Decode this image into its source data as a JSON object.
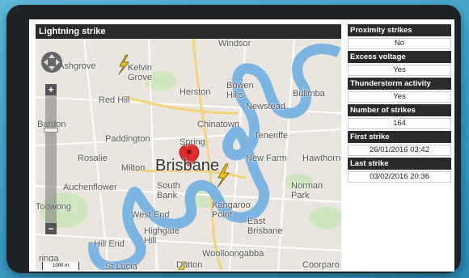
{
  "map": {
    "title": "Lightning strike",
    "labels": {
      "ashgrove": "Ashgrove",
      "kelvin_grove": "Kelvin\nGrove",
      "windsor": "Windsor",
      "red_hill": "Red Hill",
      "herston": "Herston",
      "bowen_hills": "Bowen\nHills",
      "bulimba": "Bulimba",
      "bardon": "Bardon",
      "newstead": "Newstead",
      "chinatown": "Chinatown",
      "paddington": "Paddington",
      "spring": "Spring",
      "teneriffe": "Teneriffe",
      "rosalie": "Rosalie",
      "milton": "Milton",
      "brisbane": "Brisbane",
      "new_farm": "New Farm",
      "hawthorne": "Hawthorne",
      "auchenflower": "Auchenflower",
      "south_bank": "South\nBank",
      "norman_park": "Norman\nPark",
      "toowong": "Toowong",
      "kangaroo_point": "Kangaroo\nPoint",
      "west_end": "West End",
      "highgate_hill": "Highgate\nHill",
      "east_brisbane": "East\nBrisbane",
      "hill_end": "Hill End",
      "woolloongabba": "Woolloongabba",
      "ringa": "ringa",
      "dutton": "Dutton",
      "st_lucia": "St Lucia",
      "coorparo": "Coorparo"
    },
    "scale": "1000 m",
    "zoom_in": "+",
    "zoom_out": "−"
  },
  "info": {
    "proximity_label": "Proximity strikes",
    "proximity_value": "No",
    "excess_voltage_label": "Excess voltage",
    "excess_voltage_value": "Yes",
    "thunderstorm_label": "Thunderstorm activity",
    "thunderstorm_value": "Yes",
    "strikes_label": "Number of strikes",
    "strikes_value": "164",
    "first_strike_label": "First strike",
    "first_strike_value": "26/01/2016 03:42",
    "last_strike_label": "Last strike",
    "last_strike_value": "03/02/2016 20:36"
  },
  "colors": {
    "river": "#7cb4e2",
    "park": "#cfe6c0",
    "road": "#ffffff",
    "highway": "#f4d27a",
    "marker": "#e22b2b",
    "lightning": "#f0c419",
    "header_bg": "#2b2b2b"
  },
  "icons": {
    "marker": "map-pin-icon",
    "lightning": "lightning-bolt-icon",
    "pan": "pan-arrows-icon"
  }
}
